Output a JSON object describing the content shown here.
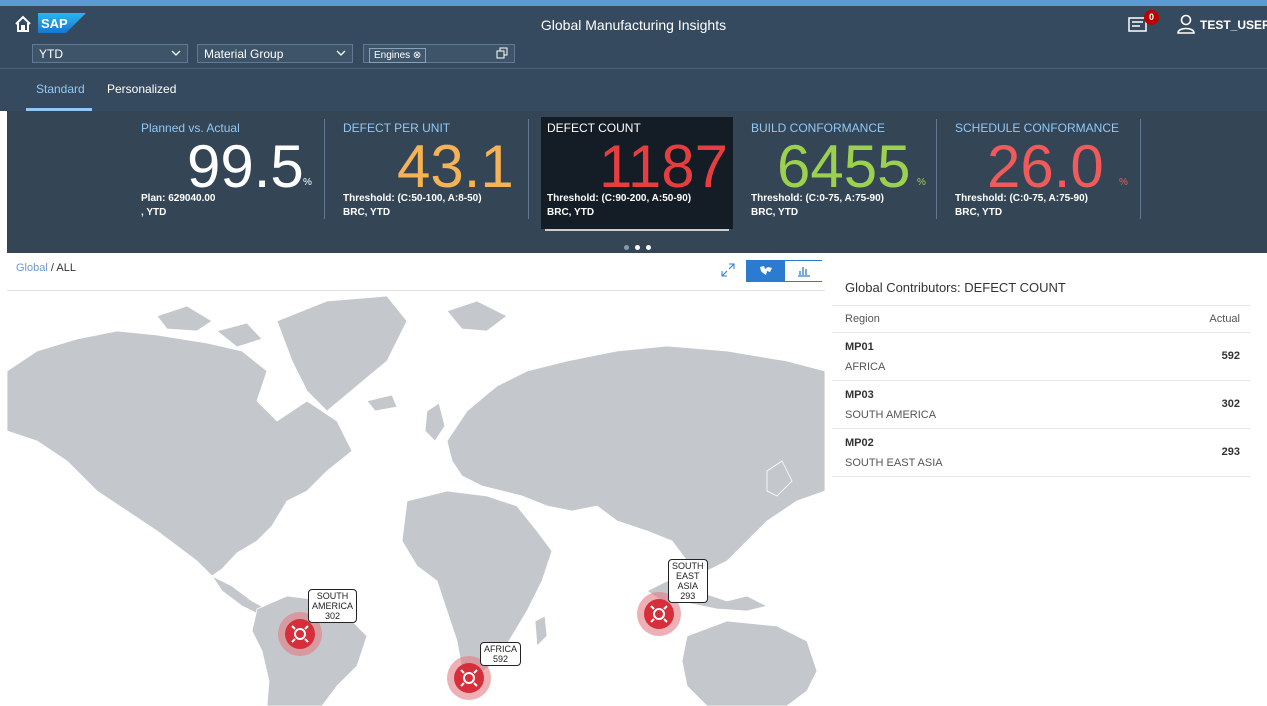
{
  "shell": {
    "title": "Global Manufacturing Insights",
    "logo_text": "SAP",
    "notification_count": "0",
    "user": "TEST_USER"
  },
  "filters": {
    "period": "YTD",
    "group": "Material Group",
    "token": "Engines"
  },
  "tabs": [
    "Standard",
    "Personalized"
  ],
  "kpis": [
    {
      "title": "Planned vs. Actual",
      "value": "99.5",
      "unit": "%",
      "line1": "Plan: 629040.00",
      "line2": ", YTD",
      "color": "#ffffff"
    },
    {
      "title": "DEFECT PER UNIT",
      "value": "43.1",
      "unit": "",
      "line1": "Threshold: (C:50-100, A:8-50)",
      "line2": "BRC, YTD",
      "color": "#f6b355"
    },
    {
      "title": "DEFECT COUNT",
      "value": "1187",
      "unit": "",
      "line1": "Threshold: (C:90-200, A:50-90)",
      "line2": "BRC, YTD",
      "color": "#e63e3e"
    },
    {
      "title": "BUILD CONFORMANCE",
      "value": "6455",
      "unit": "%",
      "line1": "Threshold: (C:0-75, A:75-90)",
      "line2": "BRC, YTD",
      "color": "#9bd14e"
    },
    {
      "title": "SCHEDULE CONFORMANCE",
      "value": "26.0",
      "unit": "%",
      "line1": "Threshold: (C:0-75, A:75-90)",
      "line2": "BRC, YTD",
      "color": "#f05a5a"
    }
  ],
  "breadcrumb": {
    "link": "Global",
    "sep": " / ",
    "current": "ALL"
  },
  "map": {
    "markers": [
      {
        "lines": [
          "SOUTH",
          "AMERICA",
          "302"
        ]
      },
      {
        "lines": [
          "AFRICA",
          "592"
        ]
      },
      {
        "lines": [
          "SOUTH",
          "EAST",
          "ASIA",
          "293"
        ]
      }
    ],
    "marker_color": "#d62f3b"
  },
  "panel": {
    "title": "Global Contributors: DEFECT COUNT",
    "col_region": "Region",
    "col_actual": "Actual",
    "rows": [
      {
        "code": "MP01",
        "name": "AFRICA",
        "actual": "592"
      },
      {
        "code": "MP03",
        "name": "SOUTH AMERICA",
        "actual": "302"
      },
      {
        "code": "MP02",
        "name": "SOUTH EAST ASIA",
        "actual": "293"
      }
    ]
  }
}
